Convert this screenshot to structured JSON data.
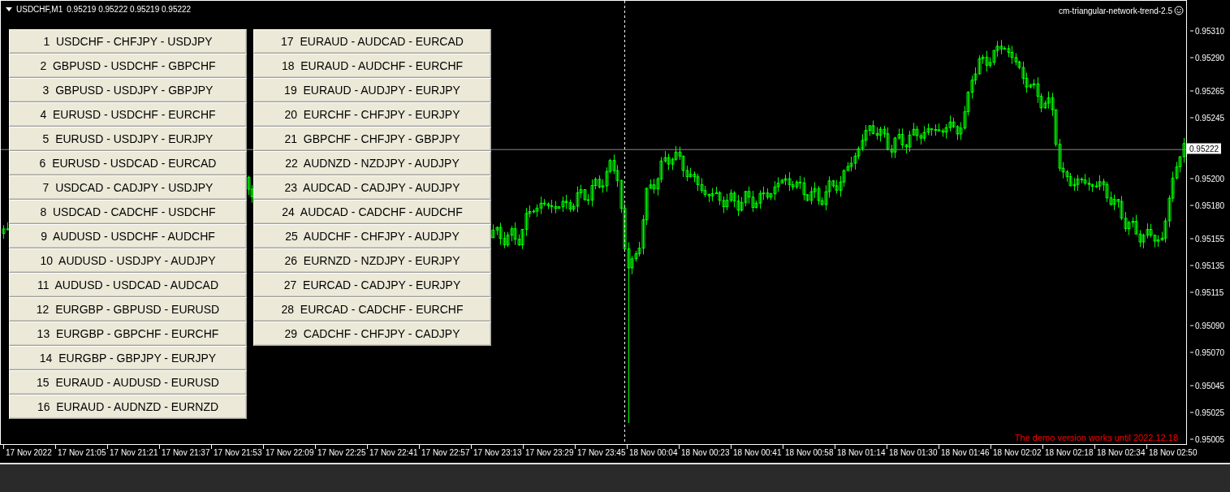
{
  "chart": {
    "symbol": "USDCHF,M1",
    "quote": "0.95219 0.95222 0.95219 0.95222",
    "indicator": "cm-triangular-network-trend-2.5",
    "demo_notice": "The demo version works until 2022.12.18",
    "current_price": "0.95222",
    "price_ticks": [
      "0.95310",
      "0.95290",
      "0.95265",
      "0.95245",
      "0.95200",
      "0.95180",
      "0.95155",
      "0.95135",
      "0.95115",
      "0.95090",
      "0.95070",
      "0.95045",
      "0.95025",
      "0.95005"
    ],
    "time_ticks": [
      "17 Nov 2022",
      "17 Nov 21:05",
      "17 Nov 21:21",
      "17 Nov 21:37",
      "17 Nov 21:53",
      "17 Nov 22:09",
      "17 Nov 22:25",
      "17 Nov 22:41",
      "17 Nov 22:57",
      "17 Nov 23:13",
      "17 Nov 23:29",
      "17 Nov 23:45",
      "18 Nov 00:04",
      "18 Nov 00:23",
      "18 Nov 00:41",
      "18 Nov 00:58",
      "18 Nov 01:14",
      "18 Nov 01:30",
      "18 Nov 01:46",
      "18 Nov 02:02",
      "18 Nov 02:18",
      "18 Nov 02:34",
      "18 Nov 02:50"
    ]
  },
  "buttons": [
    {
      "label": "1  USDCHF - CHFJPY - USDJPY"
    },
    {
      "label": "2  GBPUSD - USDCHF - GBPCHF"
    },
    {
      "label": "3  GBPUSD - USDJPY - GBPJPY"
    },
    {
      "label": "4  EURUSD - USDCHF - EURCHF"
    },
    {
      "label": "5  EURUSD - USDJPY - EURJPY"
    },
    {
      "label": "6  EURUSD - USDCAD - EURCAD"
    },
    {
      "label": "7  USDCAD - CADJPY - USDJPY"
    },
    {
      "label": "8  USDCAD - CADCHF - USDCHF"
    },
    {
      "label": "9  AUDUSD - USDCHF - AUDCHF"
    },
    {
      "label": "10  AUDUSD - USDJPY - AUDJPY"
    },
    {
      "label": "11  AUDUSD - USDCAD - AUDCAD"
    },
    {
      "label": "12  EURGBP - GBPUSD - EURUSD"
    },
    {
      "label": "13  EURGBP - GBPCHF - EURCHF"
    },
    {
      "label": "14  EURGBP - GBPJPY - EURJPY"
    },
    {
      "label": "15  EURAUD - AUDUSD - EURUSD"
    },
    {
      "label": "16  EURAUD - AUDNZD - EURNZD"
    },
    {
      "label": "17  EURAUD - AUDCAD - EURCAD"
    },
    {
      "label": "18  EURAUD - AUDCHF - EURCHF"
    },
    {
      "label": "19  EURAUD - AUDJPY - EURJPY"
    },
    {
      "label": "20  EURCHF - CHFJPY - EURJPY"
    },
    {
      "label": "21  GBPCHF - CHFJPY - GBPJPY"
    },
    {
      "label": "22  AUDNZD - NZDJPY - AUDJPY"
    },
    {
      "label": "23  AUDCAD - CADJPY - AUDJPY"
    },
    {
      "label": "24  AUDCAD - CADCHF - AUDCHF"
    },
    {
      "label": "25  AUDCHF - CHFJPY - AUDJPY"
    },
    {
      "label": "26  EURNZD - NZDJPY - EURJPY"
    },
    {
      "label": "27  EURCAD - CADJPY - EURJPY"
    },
    {
      "label": "28  EURCAD - CADCHF - EURCHF"
    },
    {
      "label": "29  CADCHF - CHFJPY - CADJPY"
    }
  ]
}
